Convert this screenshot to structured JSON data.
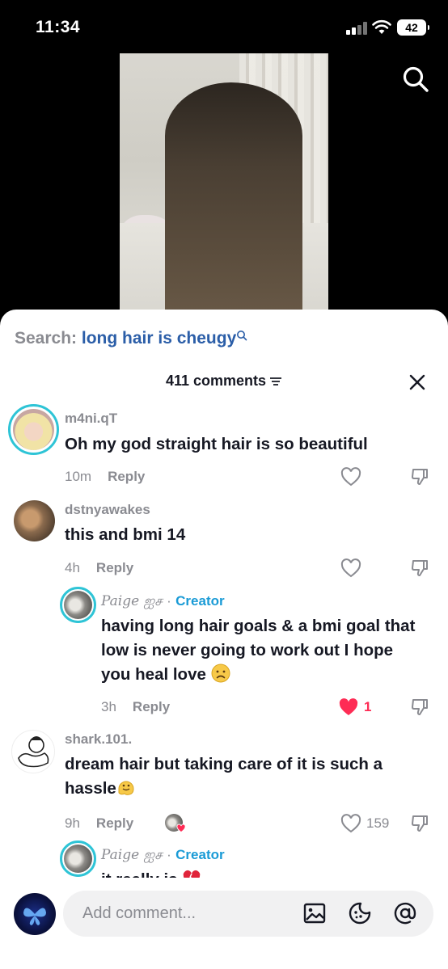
{
  "status_bar": {
    "time": "11:34",
    "battery": "42"
  },
  "search": {
    "prefix": "Search:",
    "term": "long hair is cheugy"
  },
  "comments_header": {
    "count_label": "411 comments"
  },
  "comments": [
    {
      "user": "m4ni.qT",
      "text": "Oh my god straight hair is so beautiful",
      "time": "10m",
      "reply": "Reply"
    },
    {
      "user": "dstnyawakes",
      "text": "this and bmi 14",
      "time": "4h",
      "reply": "Reply"
    },
    {
      "user": "Paige ஐச",
      "dot": "·",
      "badge": "Creator",
      "text": "having long hair goals & a bmi goal that low is never going to work out I hope you heal love",
      "time": "3h",
      "reply": "Reply",
      "likes": "1"
    },
    {
      "user": "shark.101.",
      "text": "dream hair but taking care of it is such a hassle",
      "time": "9h",
      "reply": "Reply",
      "likes": "159"
    },
    {
      "user": "Paige ஐச",
      "dot": "·",
      "badge": "Creator",
      "text": "it really is"
    }
  ],
  "composer": {
    "placeholder": "Add comment..."
  },
  "colors": {
    "accent_blue": "#2b5ea8",
    "creator_blue": "#1a9bd6",
    "like_red": "#fe2c55",
    "muted": "#8a8b91"
  },
  "icons": [
    "search-icon",
    "filter-icon",
    "close-icon",
    "heart-icon",
    "dislike-icon",
    "image-icon",
    "sticker-icon",
    "mention-icon"
  ]
}
